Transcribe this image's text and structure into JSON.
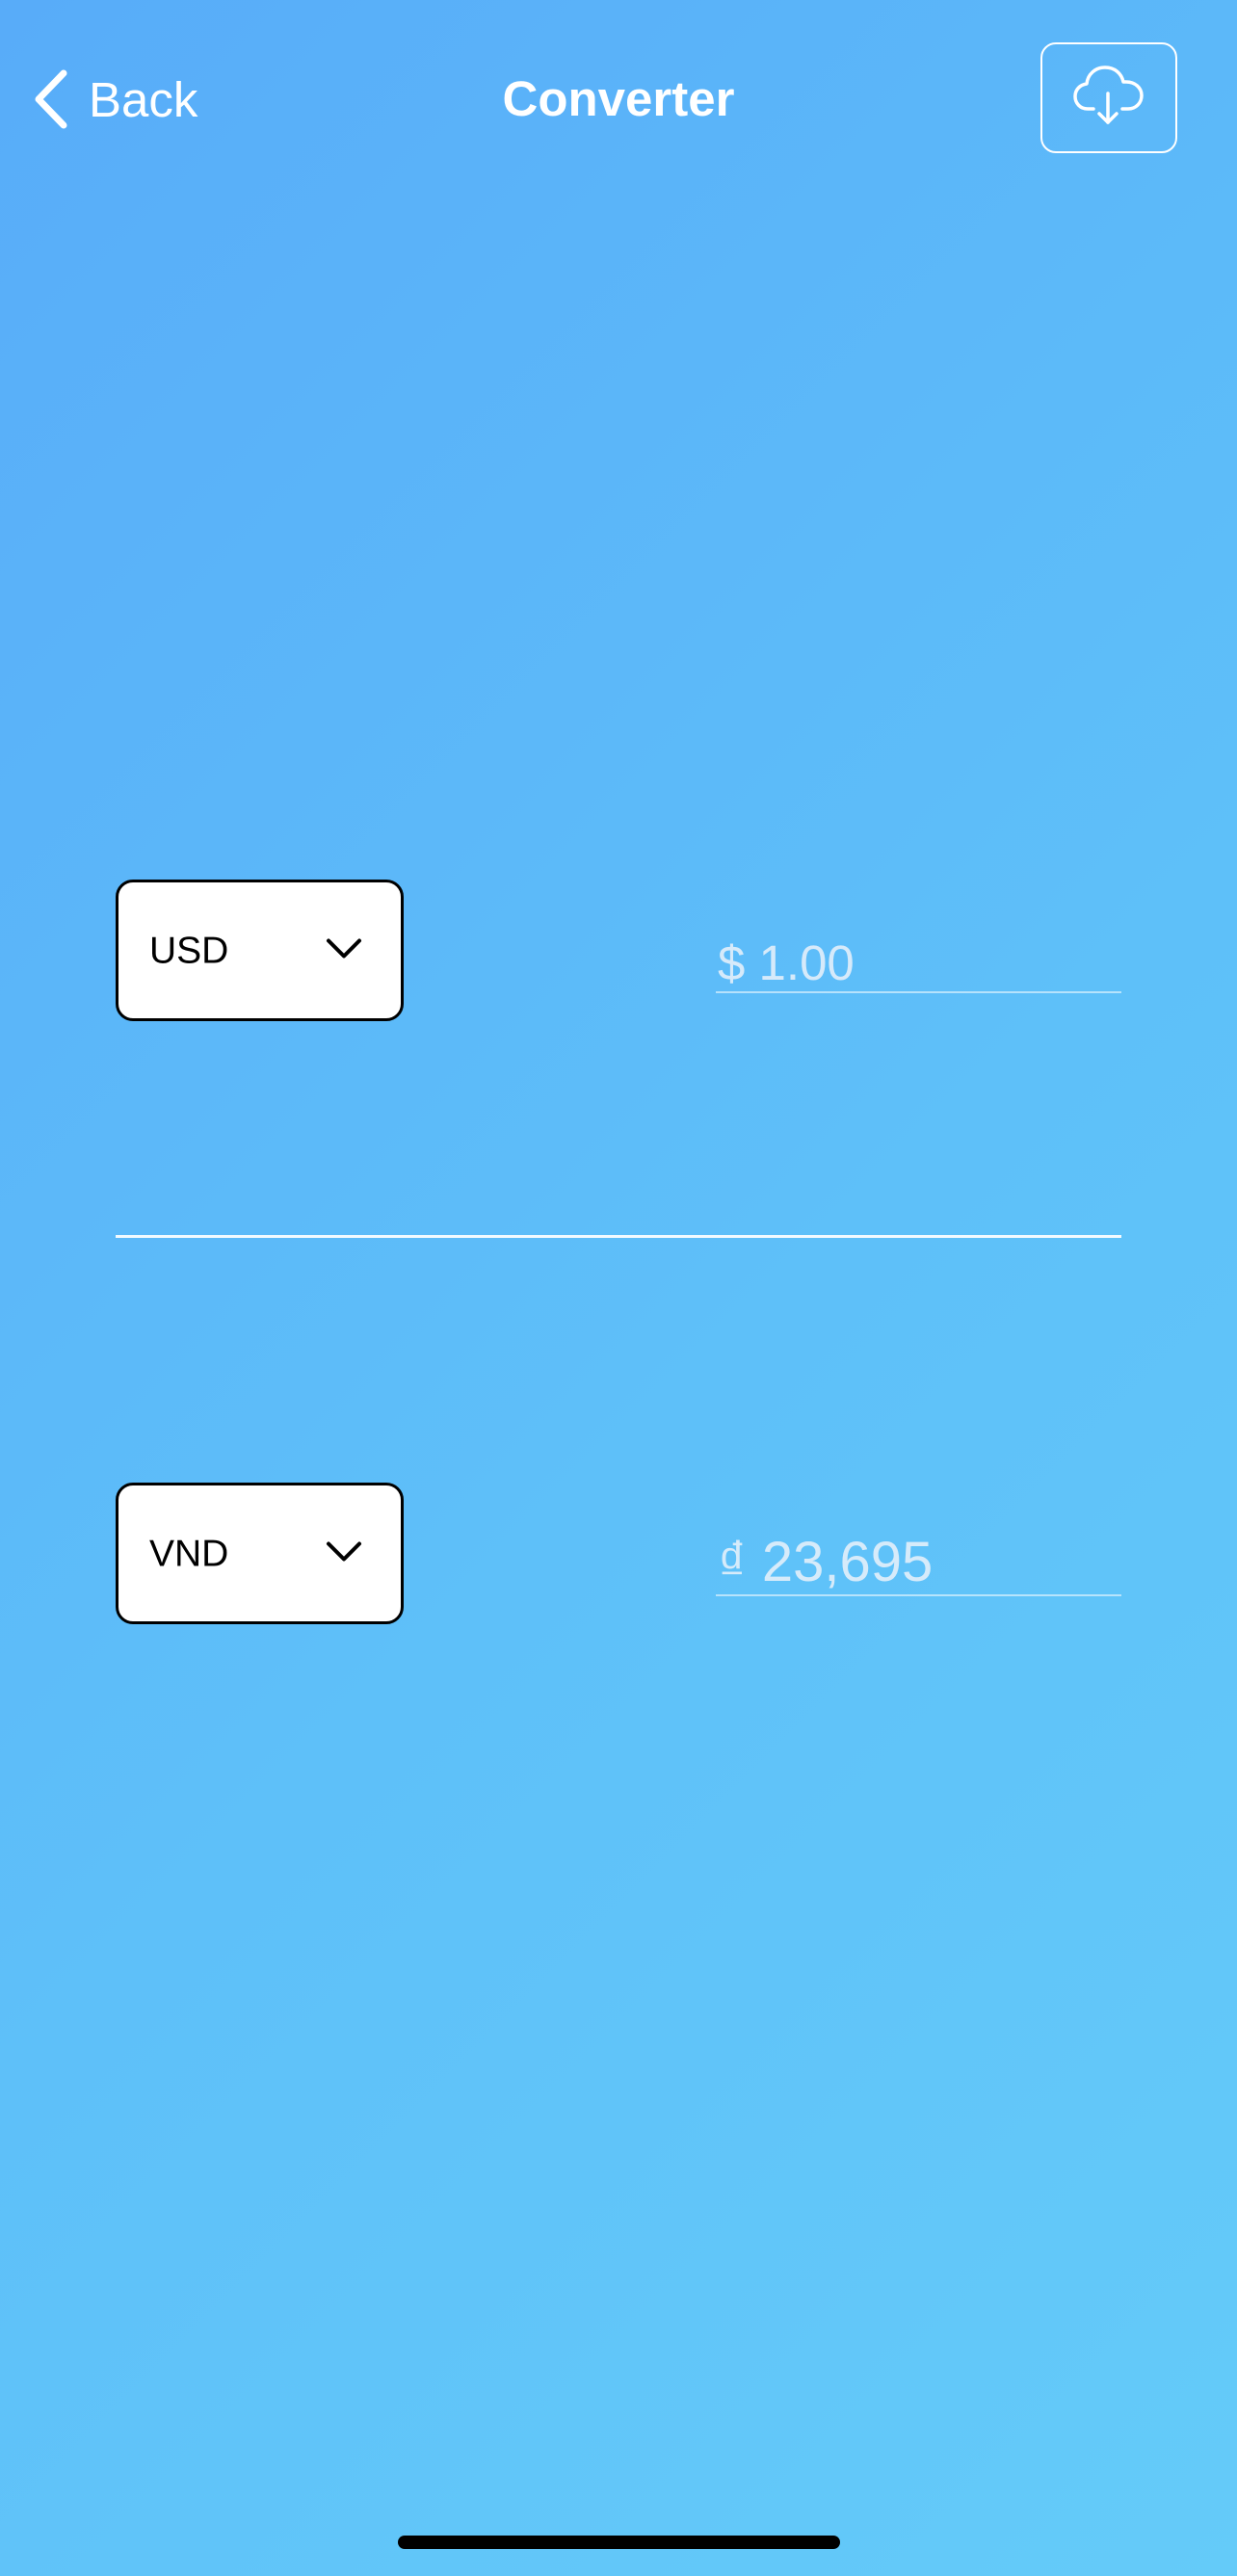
{
  "nav": {
    "back_label": "Back",
    "title": "Converter",
    "cloud_icon": "cloud-download-icon",
    "back_icon": "chevron-left-icon"
  },
  "converter": {
    "from": {
      "currency": "USD",
      "amount": "$ 1.00"
    },
    "to": {
      "currency": "VND",
      "amount": "₫ 23,695"
    },
    "dropdown_icon": "chevron-down-icon"
  },
  "colors": {
    "background_start": "#58acf9",
    "background_end": "#64cbf9",
    "foreground": "#ffffff",
    "select_background": "#ffffff",
    "select_border": "#000000"
  }
}
